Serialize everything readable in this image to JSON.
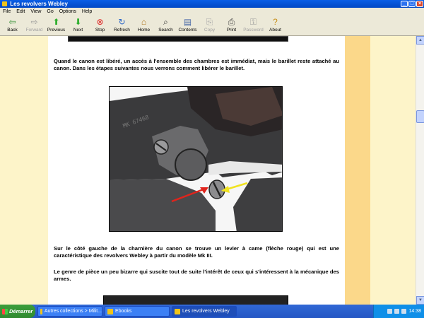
{
  "window": {
    "title": "Les revolvers Webley"
  },
  "menu": [
    "File",
    "Edit",
    "View",
    "Go",
    "Options",
    "Help"
  ],
  "toolbar": [
    {
      "label": "Back",
      "icon": "back-arrow-icon",
      "glyph": "⇦",
      "enabled": true
    },
    {
      "label": "Forward",
      "icon": "forward-arrow-icon",
      "glyph": "⇨",
      "enabled": false
    },
    {
      "label": "Previous",
      "icon": "up-arrow-icon",
      "glyph": "⬆",
      "enabled": true
    },
    {
      "label": "Next",
      "icon": "down-arrow-icon",
      "glyph": "⬇",
      "enabled": true
    },
    {
      "label": "Stop",
      "icon": "stop-icon",
      "glyph": "⊗",
      "enabled": true
    },
    {
      "label": "Refresh",
      "icon": "refresh-icon",
      "glyph": "↻",
      "enabled": true
    },
    {
      "label": "Home",
      "icon": "home-icon",
      "glyph": "⌂",
      "enabled": true
    },
    {
      "label": "Search",
      "icon": "search-icon",
      "glyph": "⌕",
      "enabled": true
    },
    {
      "label": "Contents",
      "icon": "contents-icon",
      "glyph": "▤",
      "enabled": true
    },
    {
      "label": "Copy",
      "icon": "copy-icon",
      "glyph": "⎘",
      "enabled": false
    },
    {
      "label": "Print",
      "icon": "print-icon",
      "glyph": "⎙",
      "enabled": true
    },
    {
      "label": "Password",
      "icon": "key-icon",
      "glyph": "⚿",
      "enabled": false
    },
    {
      "label": "About",
      "icon": "about-icon",
      "glyph": "?",
      "enabled": true
    }
  ],
  "content": {
    "paragraph1": "Quand le canon est libéré, un accès à l'ensemble des chambres est immédiat, mais le barillet reste attaché au canon. Dans les étapes suivantes nous verrons comment libérer le barillet.",
    "paragraph2": "Sur le côté gauche de la charnière du canon se trouve un levier à came (flèche rouge) qui est une caractéristique des revolvers Webley à partir du modèle Mk III.",
    "paragraph3": "Le genre de pièce un peu bizarre qui suscite tout de suite l'intérêt de ceux qui s'intéressent à la mécanique des armes."
  },
  "taskbar": {
    "start_label": "Démarrer",
    "tasks": [
      {
        "label": "Autres collections > Milit...",
        "active": false
      },
      {
        "label": "Ebooks",
        "active": false
      },
      {
        "label": "Les revolvers Webley",
        "active": true
      }
    ],
    "clock": "14:38"
  },
  "colors": {
    "background": "#fdf4c9",
    "accent_stripe": "#fbd88a",
    "titlebar": "#0a5ee6"
  }
}
